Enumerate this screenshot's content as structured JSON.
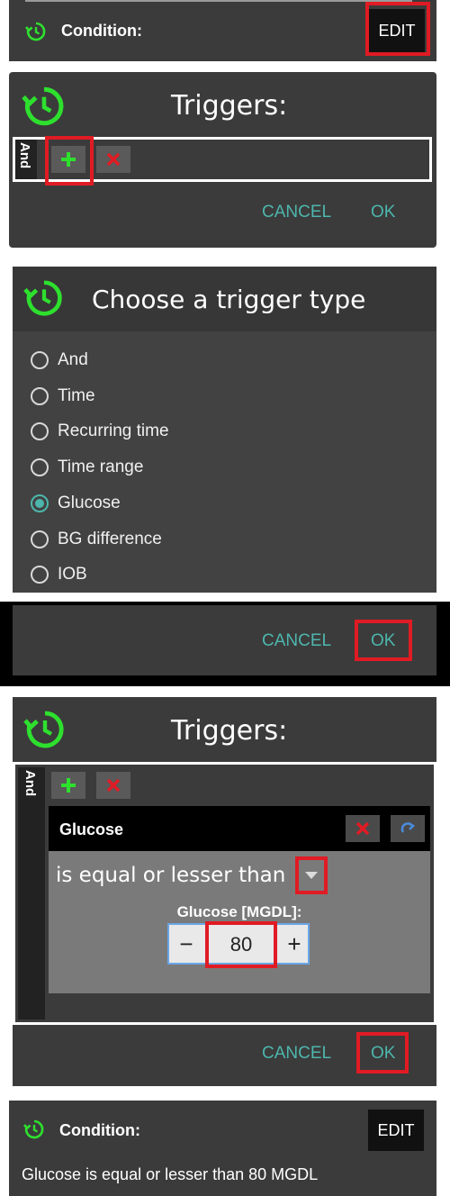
{
  "panel1": {
    "condition_label": "Condition:",
    "edit_label": "EDIT"
  },
  "panel2": {
    "title": "Triggers:",
    "and_label": "And",
    "cancel_label": "CANCEL",
    "ok_label": "OK"
  },
  "panel3": {
    "title": "Choose a trigger type",
    "options": [
      {
        "label": "And",
        "selected": false
      },
      {
        "label": "Time",
        "selected": false
      },
      {
        "label": "Recurring time",
        "selected": false
      },
      {
        "label": "Time range",
        "selected": false
      },
      {
        "label": "Glucose",
        "selected": true
      },
      {
        "label": "BG difference",
        "selected": false
      },
      {
        "label": "IOB",
        "selected": false
      }
    ]
  },
  "panel4": {
    "cancel_label": "CANCEL",
    "ok_label": "OK"
  },
  "panel5": {
    "title": "Triggers:",
    "and_label": "And",
    "glucose_header": "Glucose",
    "comparator": "is equal or lesser than",
    "field_label": "Glucose [MGDL]:",
    "value": "80",
    "minus": "−",
    "plus": "+",
    "cancel_label": "CANCEL",
    "ok_label": "OK"
  },
  "panel6": {
    "condition_label": "Condition:",
    "edit_label": "EDIT",
    "summary": "Glucose is equal or lesser than 80 MGDL"
  },
  "colors": {
    "accent": "#4db6ac",
    "icon_green": "#2ee02e",
    "highlight_red": "#e01b24",
    "panel": "#3b3b3b"
  },
  "icons": [
    "history-icon",
    "plus-icon",
    "x-icon",
    "dropdown-arrow-icon",
    "refresh-icon"
  ]
}
